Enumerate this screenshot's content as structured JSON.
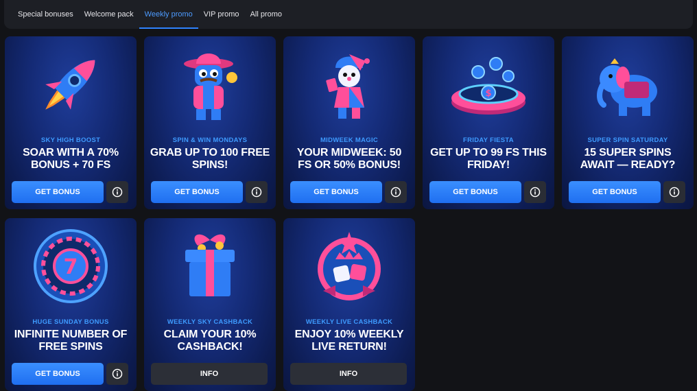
{
  "tabs": [
    {
      "label": "Special bonuses"
    },
    {
      "label": "Welcome pack"
    },
    {
      "label": "Weekly promo"
    },
    {
      "label": "VIP promo"
    },
    {
      "label": "All promo"
    }
  ],
  "active_tab": "Weekly promo",
  "colors": {
    "accent": "#2f83ff",
    "subtitle": "#3e9bff",
    "card_bg": "#142a75",
    "page_bg": "#121317"
  },
  "cards": [
    {
      "icon": "rocket-icon",
      "subtitle": "SKY HIGH BOOST",
      "title": "SOAR WITH A 70% BONUS + 70 FS",
      "button": "GET BONUS",
      "info_icon": "info-icon"
    },
    {
      "icon": "cowboy-robot-icon",
      "subtitle": "SPIN & WIN MONDAYS",
      "title": "GRAB UP TO 100 FREE SPINS!",
      "button": "GET BONUS",
      "info_icon": "info-icon"
    },
    {
      "icon": "jester-icon",
      "subtitle": "MIDWEEK MAGIC",
      "title": "YOUR MIDWEEK: 50 FS OR 50% BONUS!",
      "button": "GET BONUS",
      "info_icon": "info-icon"
    },
    {
      "icon": "coin-fountain-icon",
      "subtitle": "FRIDAY FIESTA",
      "title": "GET UP TO 99 FS THIS FRIDAY!",
      "button": "GET BONUS",
      "info_icon": "info-icon"
    },
    {
      "icon": "elephant-icon",
      "subtitle": "SUPER SPIN SATURDAY",
      "title": "15 SUPER SPINS AWAIT — READY?",
      "button": "GET BONUS",
      "info_icon": "info-icon"
    },
    {
      "icon": "lucky-seven-wheel-icon",
      "subtitle": "HUGE SUNDAY BONUS",
      "title": "INFINITE NUMBER OF FREE SPINS",
      "button": "GET BONUS",
      "info_icon": "info-icon"
    },
    {
      "icon": "gift-box-icon",
      "subtitle": "WEEKLY SKY CASHBACK",
      "title": "CLAIM YOUR 10% CASHBACK!",
      "button": "INFO"
    },
    {
      "icon": "dice-crown-icon",
      "subtitle": "WEEKLY LIVE CASHBACK",
      "title": "ENJOY 10% WEEKLY LIVE RETURN!",
      "button": "INFO"
    }
  ]
}
